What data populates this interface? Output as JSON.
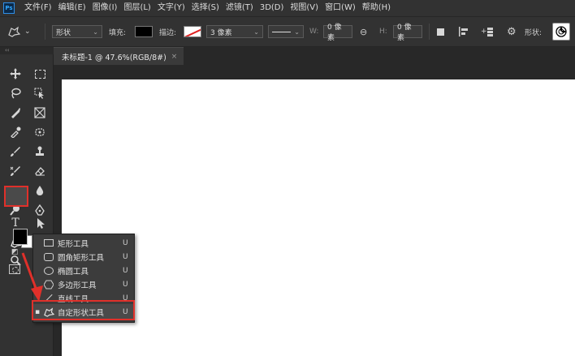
{
  "app": {
    "logo": "Ps"
  },
  "menu": [
    "文件(F)",
    "编辑(E)",
    "图像(I)",
    "图层(L)",
    "文字(Y)",
    "选择(S)",
    "滤镜(T)",
    "3D(D)",
    "视图(V)",
    "窗口(W)",
    "帮助(H)"
  ],
  "options": {
    "mode": "形状",
    "fill_label": "填充:",
    "stroke_label": "描边:",
    "stroke_size": "3 像素",
    "w_label": "W:",
    "w_value": "0 像素",
    "h_label": "H:",
    "h_value": "0 像素",
    "shape_label": "形状:"
  },
  "document_tab": {
    "title": "未标题-1 @ 47.6%(RGB/8#)",
    "close": "×"
  },
  "toolbar": {
    "collapse": "‹‹"
  },
  "flyout": {
    "items": [
      {
        "label": "矩形工具",
        "key": "U",
        "icon": "rectangle-icon",
        "selected": false
      },
      {
        "label": "圆角矩形工具",
        "key": "U",
        "icon": "rounded-rectangle-icon",
        "selected": false
      },
      {
        "label": "椭圆工具",
        "key": "U",
        "icon": "ellipse-icon",
        "selected": false
      },
      {
        "label": "多边形工具",
        "key": "U",
        "icon": "polygon-icon",
        "selected": false
      },
      {
        "label": "直线工具",
        "key": "U",
        "icon": "line-icon",
        "selected": false
      },
      {
        "label": "自定形状工具",
        "key": "U",
        "icon": "custom-shape-icon",
        "selected": true
      }
    ],
    "bullet": "▪"
  },
  "colors": {
    "highlight": "#e0302a",
    "foreground": "#000000",
    "background": "#ffffff"
  }
}
